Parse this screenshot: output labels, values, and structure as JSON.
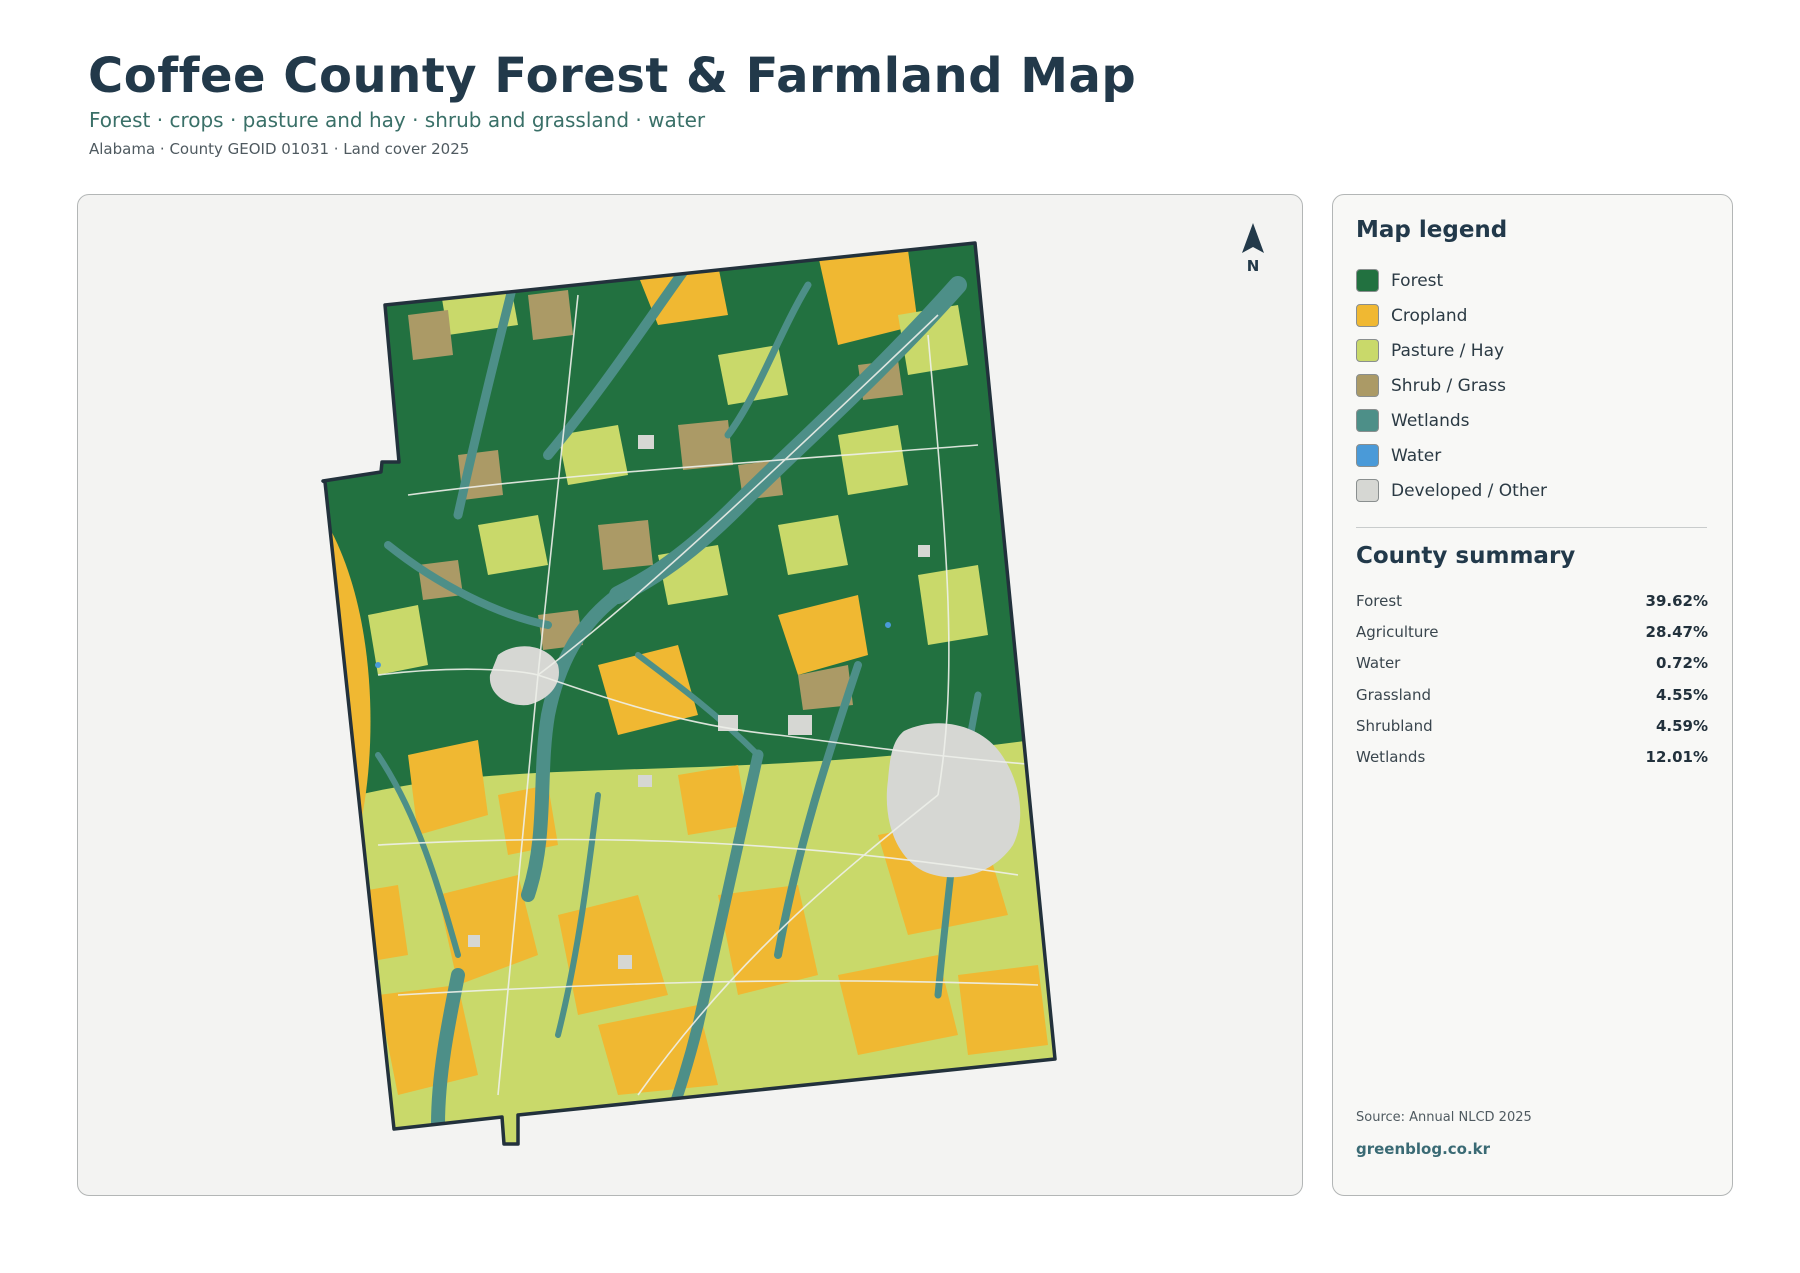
{
  "header": {
    "title": "Coffee County Forest & Farmland Map",
    "subtitle": "Forest · crops · pasture and hay · shrub and grassland · water",
    "meta": "Alabama · County GEOID 01031 · Land cover 2025"
  },
  "map": {
    "north_label": "N",
    "north_icon": "north-arrow-icon"
  },
  "legend": {
    "heading": "Map legend",
    "items": [
      {
        "label": "Forest",
        "color": "#227140"
      },
      {
        "label": "Cropland",
        "color": "#f0b832"
      },
      {
        "label": "Pasture / Hay",
        "color": "#c9d96a"
      },
      {
        "label": "Shrub / Grass",
        "color": "#ab9a66"
      },
      {
        "label": "Wetlands",
        "color": "#4d8f88"
      },
      {
        "label": "Water",
        "color": "#4a9ad8"
      },
      {
        "label": "Developed / Other",
        "color": "#d6d7d3"
      }
    ]
  },
  "summary": {
    "heading": "County summary",
    "rows": [
      {
        "label": "Forest",
        "value": "39.62%"
      },
      {
        "label": "Agriculture",
        "value": "28.47%"
      },
      {
        "label": "Water",
        "value": "0.72%"
      },
      {
        "label": "Grassland",
        "value": "4.55%"
      },
      {
        "label": "Shrubland",
        "value": "4.59%"
      },
      {
        "label": "Wetlands",
        "value": "12.01%"
      }
    ]
  },
  "footer": {
    "source": "Source: Annual NLCD 2025",
    "site": "greenblog.co.kr"
  }
}
